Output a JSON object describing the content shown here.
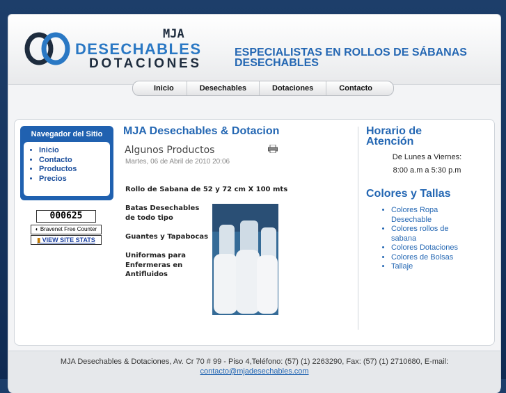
{
  "header": {
    "logo_top": "MJA",
    "logo_line1": "DESECHABLES",
    "logo_line2": "DOTACIONES",
    "tagline": "ESPECIALISTAS EN ROLLOS DE SÁBANAS DESECHABLES"
  },
  "nav": [
    "Inicio",
    "Desechables",
    "Dotaciones",
    "Contacto"
  ],
  "sidebar": {
    "title": "Navegador del Sitio",
    "items": [
      "Inicio",
      "Contacto",
      "Productos",
      "Precios"
    ],
    "counter": "000625",
    "bravenet": "Bravenet Free Counter",
    "stats": "VIEW SITE STATS"
  },
  "main": {
    "title": "MJA Desechables & Dotacion",
    "article_title": "Algunos Productos",
    "date": "Martes, 06 de Abril de 2010 20:06",
    "p1": "Rollo de Sabana de 52 y 72 cm X 100 mts",
    "p2": "Batas Desechables de todo tipo",
    "p3": "Guantes y Tapabocas",
    "p4": "Uniformas para Enfermeras en Antifluidos"
  },
  "right": {
    "hours_title": "Horario de Atención",
    "hours_line1": "De Lunes a Viernes:",
    "hours_line2": "8:00 a.m a 5:30 p.m",
    "colors_title": "Colores y Tallas",
    "colors_items": [
      "Colores Ropa Desechable",
      "Colores rollos de sabana",
      "Colores Dotaciones",
      "Colores de Bolsas",
      "Tallaje"
    ]
  },
  "footer": {
    "text": "MJA Desechables & Dotaciones, Av. Cr 70 # 99 - Piso 4,Teléfono: (57) (1)  2263290, Fax: (57) (1) 2710680, E-mail:",
    "email": "contacto@mjadesechables.com"
  },
  "colors": {
    "accent": "#2467b3",
    "nav_box": "#2061b0",
    "background": "#0f2a52"
  }
}
